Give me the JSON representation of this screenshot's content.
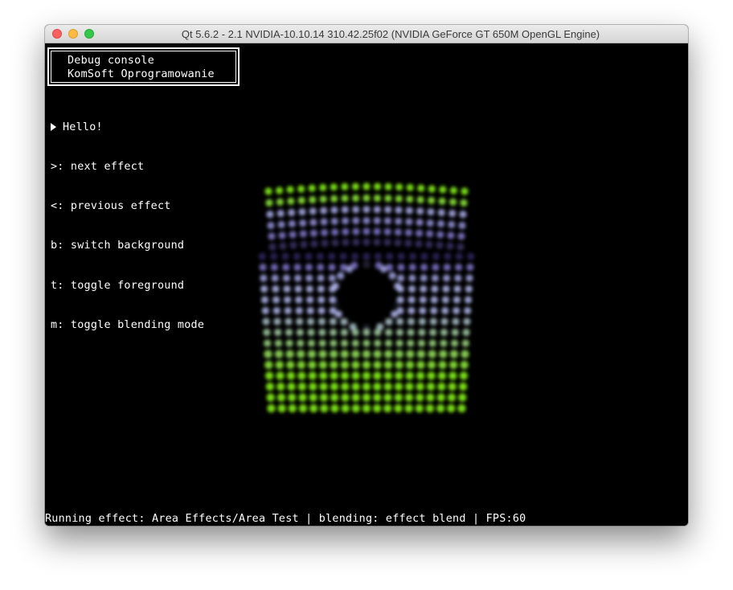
{
  "window": {
    "title": "Qt 5.6.2 - 2.1 NVIDIA-10.10.14 310.42.25f02 (NVIDIA GeForce GT 650M OpenGL Engine)"
  },
  "console": {
    "title": "Debug console",
    "subtitle": "KomSoft Oprogramowanie"
  },
  "log": {
    "hello": "Hello!"
  },
  "help": [
    ">: next effect",
    "<: previous effect",
    "b: switch background",
    "t: toggle foreground",
    "m: toggle blending mode"
  ],
  "status": {
    "text": "Running effect: Area Effects/Area Test | blending: effect blend | FPS:60"
  },
  "colors": {
    "background": "#000000",
    "text": "#ffffff",
    "particle_green": "#8cff14",
    "particle_lavender": "#b4b8f0",
    "particle_purple": "#5a46b4"
  },
  "icons": {
    "hello_marker": "right-triangle-icon"
  }
}
